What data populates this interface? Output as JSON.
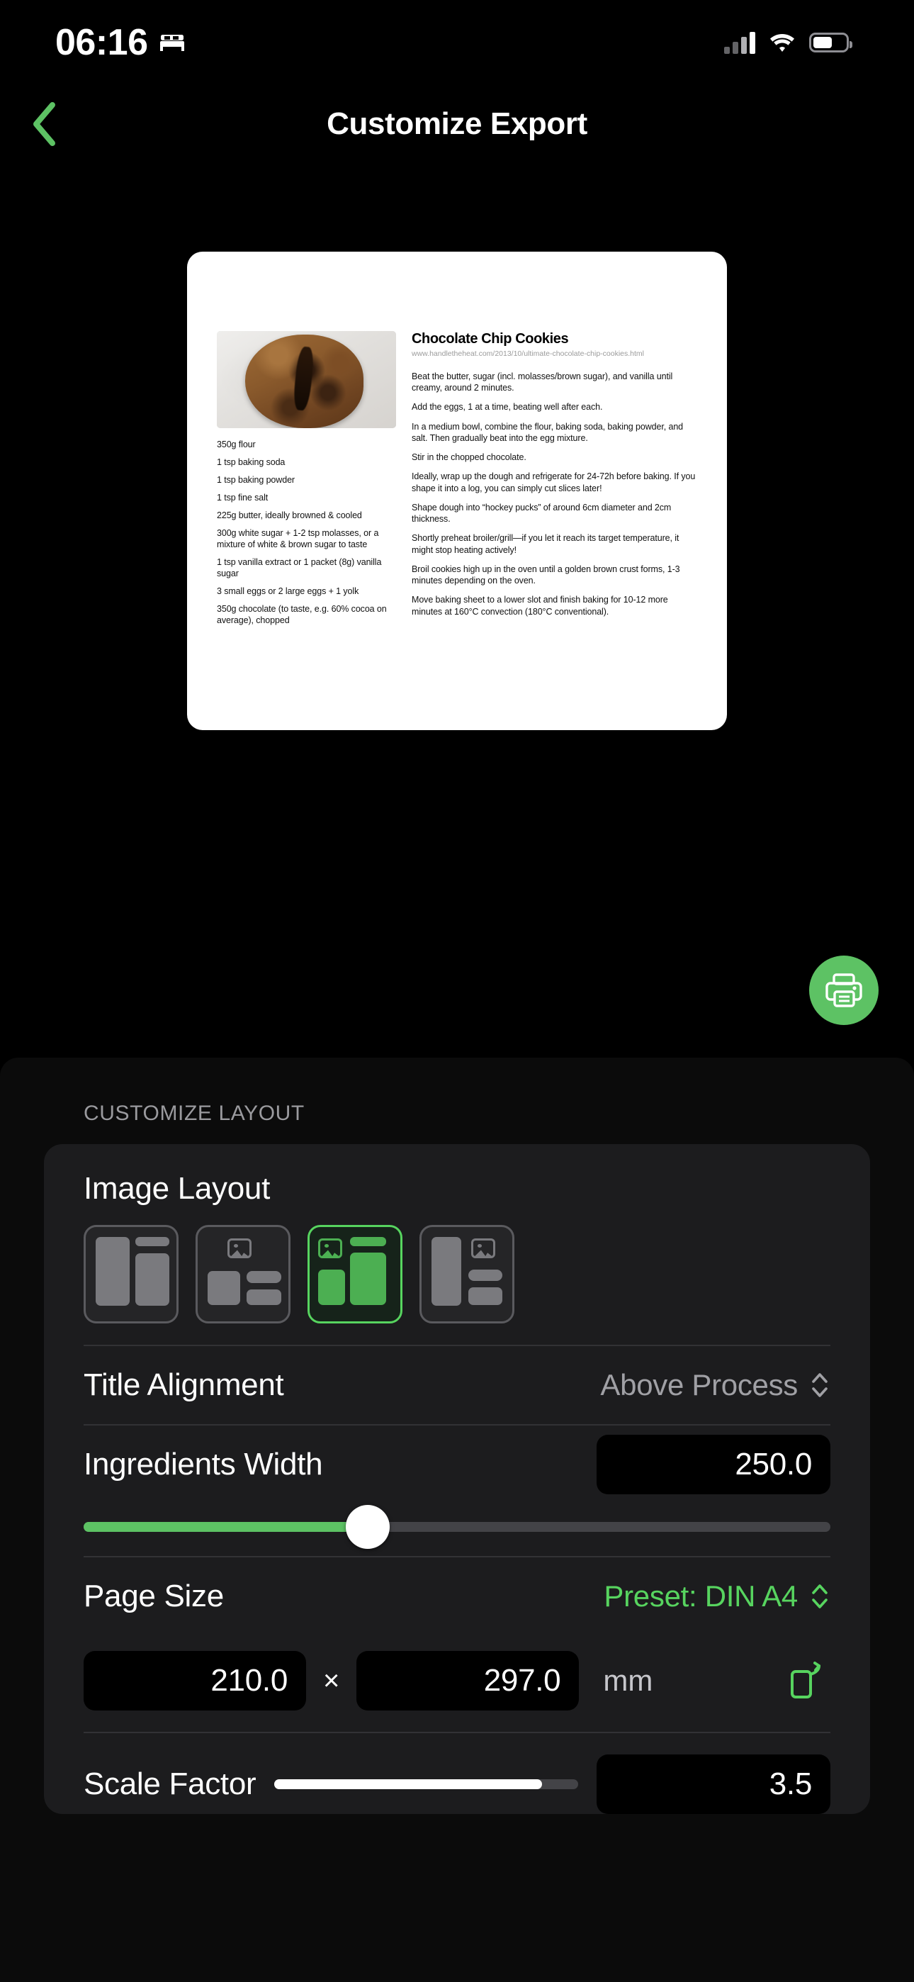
{
  "status_bar": {
    "time": "06:16",
    "focus_icon": "bed-icon",
    "signal_icon": "cellular-signal-icon",
    "wifi_icon": "wifi-icon",
    "battery_icon": "battery-icon"
  },
  "nav": {
    "back_icon": "chevron-left-icon",
    "title": "Customize Export"
  },
  "preview": {
    "recipe": {
      "title": "Chocolate Chip Cookies",
      "url": "www.handletheheat.com/2013/10/ultimate-chocolate-chip-cookies.html",
      "photo_alt": "chocolate-chip-cookie-photo",
      "ingredients": [
        "350g flour",
        "1 tsp baking soda",
        "1 tsp baking powder",
        "1 tsp fine salt",
        "225g butter, ideally browned & cooled",
        "300g white sugar + 1-2 tsp molasses, or a mixture of white & brown sugar to taste",
        "1 tsp vanilla extract or 1 packet (8g) vanilla sugar",
        "3 small eggs or 2 large eggs + 1 yolk",
        "350g chocolate (to taste, e.g. 60% cocoa on average), chopped"
      ],
      "steps": [
        "Beat the butter, sugar (incl. molasses/brown sugar), and vanilla until creamy, around 2 minutes.",
        "Add the eggs, 1 at a time, beating well after each.",
        "In a medium bowl, combine the flour, baking soda, baking powder, and salt. Then gradually beat into the egg mixture.",
        "Stir in the chopped chocolate.",
        "Ideally, wrap up the dough and refrigerate for 24-72h before baking. If you shape it into a log, you can simply cut slices later!",
        "Shape dough into “hockey pucks” of around 6cm diameter and 2cm thickness.",
        "Shortly preheat broiler/grill—if you let it reach its target temperature, it might stop heating actively!",
        "Broil cookies high up in the oven until a golden brown crust forms, 1-3 minutes depending on the oven.",
        "Move baking sheet to a lower slot and finish baking for 10-12 more minutes at 160°C convection (180°C conventional)."
      ]
    },
    "actions": {
      "print_icon": "printer-icon",
      "share_icon": "share-icon"
    }
  },
  "settings": {
    "section_header": "CUSTOMIZE LAYOUT",
    "image_layout": {
      "label": "Image Layout",
      "selected_index": 2,
      "options": [
        "layout-two-columns",
        "layout-image-top-grid",
        "layout-image-left-columns",
        "layout-sidebar-image-right"
      ]
    },
    "title_alignment": {
      "label": "Title Alignment",
      "value": "Above Process",
      "stepper_icon": "chevron-up-down-icon"
    },
    "ingredients_width": {
      "label": "Ingredients Width",
      "value": "250.0",
      "slider_percent": 38
    },
    "page_size": {
      "label": "Page Size",
      "preset_value": "Preset: DIN A4",
      "stepper_icon": "chevron-up-down-icon",
      "width": "210.0",
      "separator": "×",
      "height": "297.0",
      "unit": "mm",
      "rotate_icon": "rotate-page-icon"
    },
    "scale_factor": {
      "label": "Scale Factor",
      "value": "3.5",
      "slider_percent": 88
    }
  },
  "colors": {
    "accent_green": "#57d45f",
    "fab_green": "#5dc264",
    "sheet_bg": "#0b0b0b",
    "card_bg": "#1c1c1e"
  }
}
